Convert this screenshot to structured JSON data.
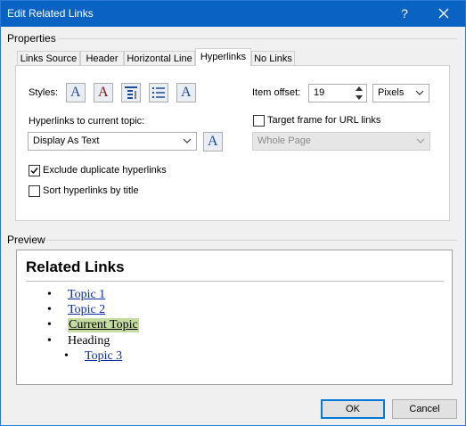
{
  "window": {
    "title": "Edit Related Links",
    "help_label": "?"
  },
  "properties": {
    "group_label": "Properties"
  },
  "tabs": [
    {
      "label": "Links Source"
    },
    {
      "label": "Header"
    },
    {
      "label": "Horizontal Line"
    },
    {
      "label": "Hyperlinks"
    },
    {
      "label": "No Links"
    }
  ],
  "hyperlinks": {
    "styles_label": "Styles:",
    "style_buttons": [
      "A",
      "A",
      "paragraph-style",
      "list-style",
      "A"
    ],
    "current_topic_label": "Hyperlinks to current topic:",
    "current_topic_value": "Display As Text",
    "current_topic_style_btn": "A",
    "exclude_duplicates_label": "Exclude duplicate hyperlinks",
    "exclude_duplicates_checked": true,
    "sort_by_title_label": "Sort hyperlinks by title",
    "sort_by_title_checked": false,
    "item_offset_label": "Item offset:",
    "item_offset_value": "19",
    "unit_value": "Pixels",
    "target_frame_label": "Target frame for URL links",
    "target_frame_checked": false,
    "target_frame_value": "Whole Page"
  },
  "preview": {
    "group_label": "Preview",
    "heading": "Related Links",
    "items": [
      {
        "text": "Topic 1",
        "kind": "link"
      },
      {
        "text": "Topic 2",
        "kind": "link"
      },
      {
        "text": "Current Topic",
        "kind": "current"
      },
      {
        "text": "Heading",
        "kind": "heading"
      },
      {
        "text": "Topic 3",
        "kind": "link"
      }
    ],
    "highlight_color": "#c5dca0",
    "link_color": "#0a2a9f"
  },
  "buttons": {
    "ok": "OK",
    "cancel": "Cancel"
  }
}
